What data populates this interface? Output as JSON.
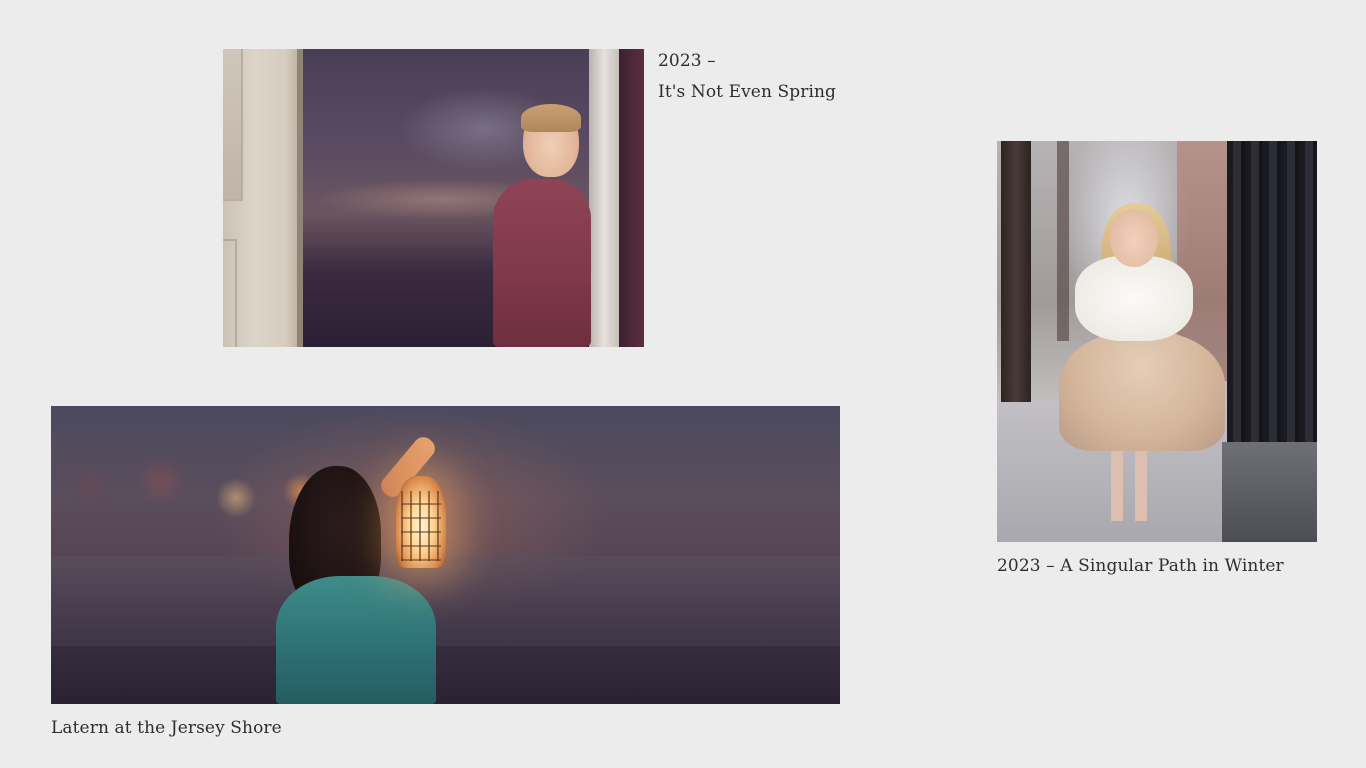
{
  "gallery": {
    "items": [
      {
        "caption_year": "2023 –",
        "caption_title": "It's Not Even Spring"
      },
      {
        "caption": "2023 – A Singular Path in Winter"
      },
      {
        "caption": "Latern at the Jersey Shore"
      }
    ]
  },
  "colors": {
    "background": "#ececec",
    "text": "#2d2d2d"
  }
}
